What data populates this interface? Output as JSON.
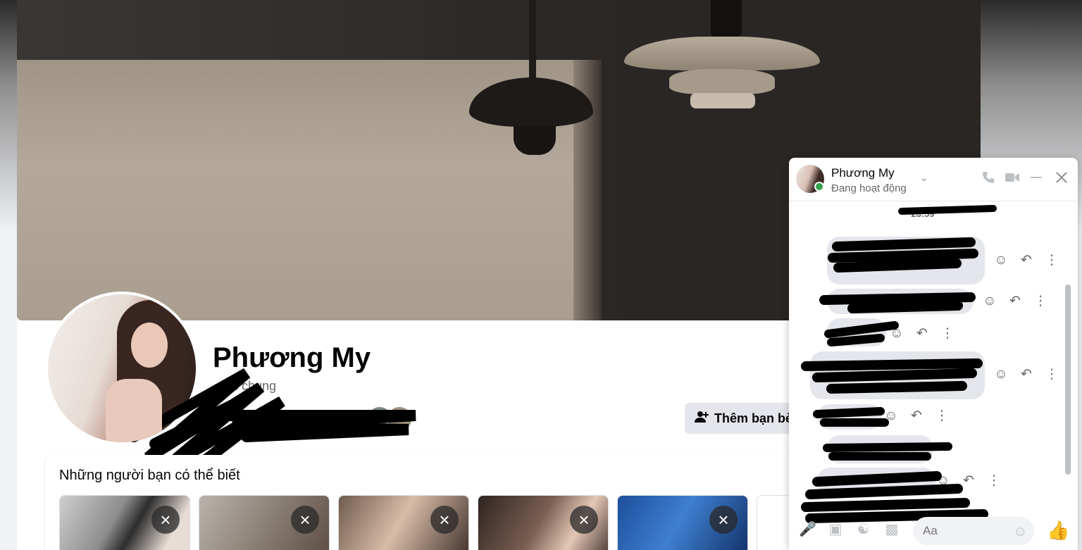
{
  "profile": {
    "name": "Phương My",
    "mutual_text": "ạn chung",
    "add_friend_label": "Thêm bạn bè"
  },
  "pymk": {
    "title": "Những người bạn có thể biết",
    "close_icon": "×"
  },
  "chat": {
    "contact_name": "Phương My",
    "status": "Đang hoạt động",
    "timestamp": "23:59",
    "input_placeholder": "Aa",
    "colors": {
      "online": "#31a24c",
      "bubble": "#e4e6eb"
    }
  }
}
